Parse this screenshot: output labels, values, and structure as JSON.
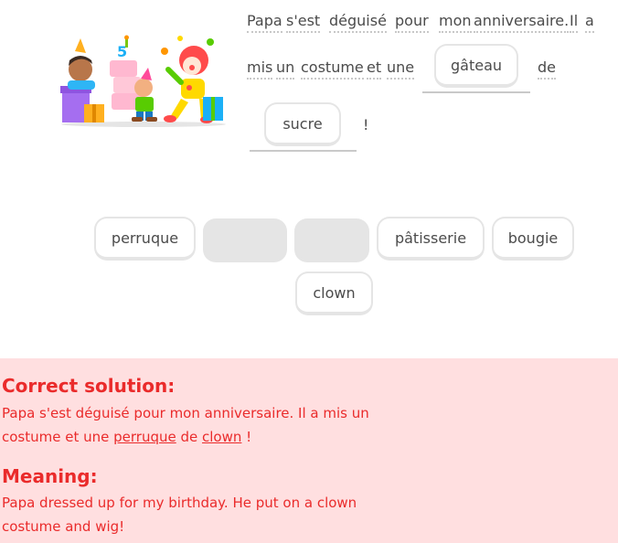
{
  "sentence": {
    "line1": [
      "Papa",
      "s'est",
      "déguisé",
      "pour",
      "mon",
      "anniversaire.",
      "Il",
      "a"
    ],
    "line2": [
      "mis",
      "un",
      "costume",
      "et",
      "une"
    ],
    "slot1_word": "gâteau",
    "after_slot1": "de",
    "slot2_word": "sucre",
    "end_punct": "!"
  },
  "word_bank": {
    "row1": [
      {
        "label": "perruque",
        "used": false
      },
      {
        "label": "",
        "used": true
      },
      {
        "label": "",
        "used": true
      },
      {
        "label": "pâtisserie",
        "used": false
      },
      {
        "label": "bougie",
        "used": false
      }
    ],
    "row2": [
      {
        "label": "clown",
        "used": false
      }
    ]
  },
  "feedback": {
    "correct_heading": "Correct solution:",
    "solution_line1": "Papa s'est déguisé pour mon anniversaire. Il a mis un",
    "solution_line2_pre": "costume et une ",
    "solution_word1": "perruque",
    "solution_mid": " de ",
    "solution_word2": "clown",
    "solution_end": " !",
    "meaning_heading": "Meaning:",
    "meaning_line1": "Papa dressed up for my birthday. He put on a clown",
    "meaning_line2": "costume and wig!",
    "colors": {
      "background": "#ffdfe0",
      "text": "#ea2b2b"
    }
  }
}
